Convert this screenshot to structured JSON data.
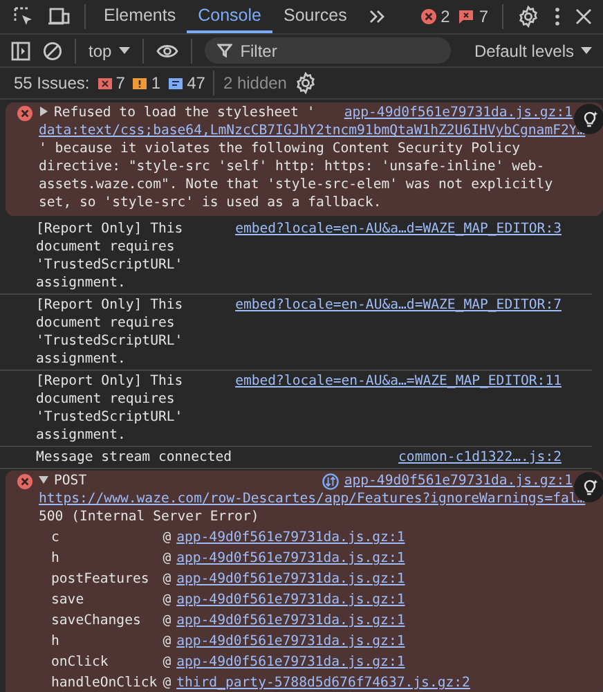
{
  "main_toolbar": {
    "tabs": [
      {
        "label": "Elements",
        "selected": false
      },
      {
        "label": "Console",
        "selected": true
      },
      {
        "label": "Sources",
        "selected": false
      }
    ],
    "error_count": "2",
    "issue_count": "7"
  },
  "console_toolbar": {
    "context": "top",
    "filter": {
      "placeholder": "Filter"
    },
    "levels": "Default levels"
  },
  "issues_bar": {
    "label": "55 Issues:",
    "counts": [
      {
        "kind": "error",
        "count": "7"
      },
      {
        "kind": "warning",
        "count": "1"
      },
      {
        "kind": "info",
        "count": "47"
      }
    ],
    "hidden": "2 hidden"
  },
  "messages": [
    {
      "kind": "error",
      "expanded": false,
      "text": "Refused to load the stylesheet '",
      "source": "app-49d0f561e79731da.js.gz:1",
      "url": "data:text/css;base64,LmNzcCB7IGJhY2tncm91bmQtaW1hZ2U6IHVybCgnamF2Y…",
      "detail": "' because it violates the following Content Security Policy directive: \"style-src 'self' http: https: 'unsafe-inline' web-assets.waze.com\". Note that 'style-src-elem' was not explicitly set, so 'style-src' is used as a fallback."
    },
    {
      "kind": "log",
      "text": "[Report Only] This document requires 'TrustedScriptURL' assignment.",
      "source": "embed?locale=en-AU&a…d=WAZE_MAP_EDITOR:3"
    },
    {
      "kind": "log",
      "text": "[Report Only] This document requires 'TrustedScriptURL' assignment.",
      "source": "embed?locale=en-AU&a…d=WAZE_MAP_EDITOR:7"
    },
    {
      "kind": "log",
      "text": "[Report Only] This document requires 'TrustedScriptURL' assignment.",
      "source": "embed?locale=en-AU&a…=WAZE_MAP_EDITOR:11"
    },
    {
      "kind": "log",
      "text": "Message stream connected",
      "source": "common-c1d1322….js:2"
    },
    {
      "kind": "network_error",
      "expanded": true,
      "text": "POST",
      "source": "app-49d0f561e79731da.js.gz:1",
      "url": "https://www.waze.com/row-Descartes/app/Features?ignoreWarnings=fal…",
      "detail": "500 (Internal Server Error)",
      "stack": [
        {
          "function": "c",
          "at": "@",
          "link": "app-49d0f561e79731da.js.gz:1"
        },
        {
          "function": "h",
          "at": "@",
          "link": "app-49d0f561e79731da.js.gz:1"
        },
        {
          "function": "postFeatures",
          "at": "@",
          "link": "app-49d0f561e79731da.js.gz:1"
        },
        {
          "function": "save",
          "at": "@",
          "link": "app-49d0f561e79731da.js.gz:1"
        },
        {
          "function": "saveChanges",
          "at": "@",
          "link": "app-49d0f561e79731da.js.gz:1"
        },
        {
          "function": "h",
          "at": "@",
          "link": "app-49d0f561e79731da.js.gz:1"
        },
        {
          "function": "onClick",
          "at": "@",
          "link": "app-49d0f561e79731da.js.gz:1"
        },
        {
          "function": "handleOnClick",
          "at": "@",
          "link": "third_party-5788d5d676f74637.js.gz:2"
        }
      ]
    }
  ]
}
